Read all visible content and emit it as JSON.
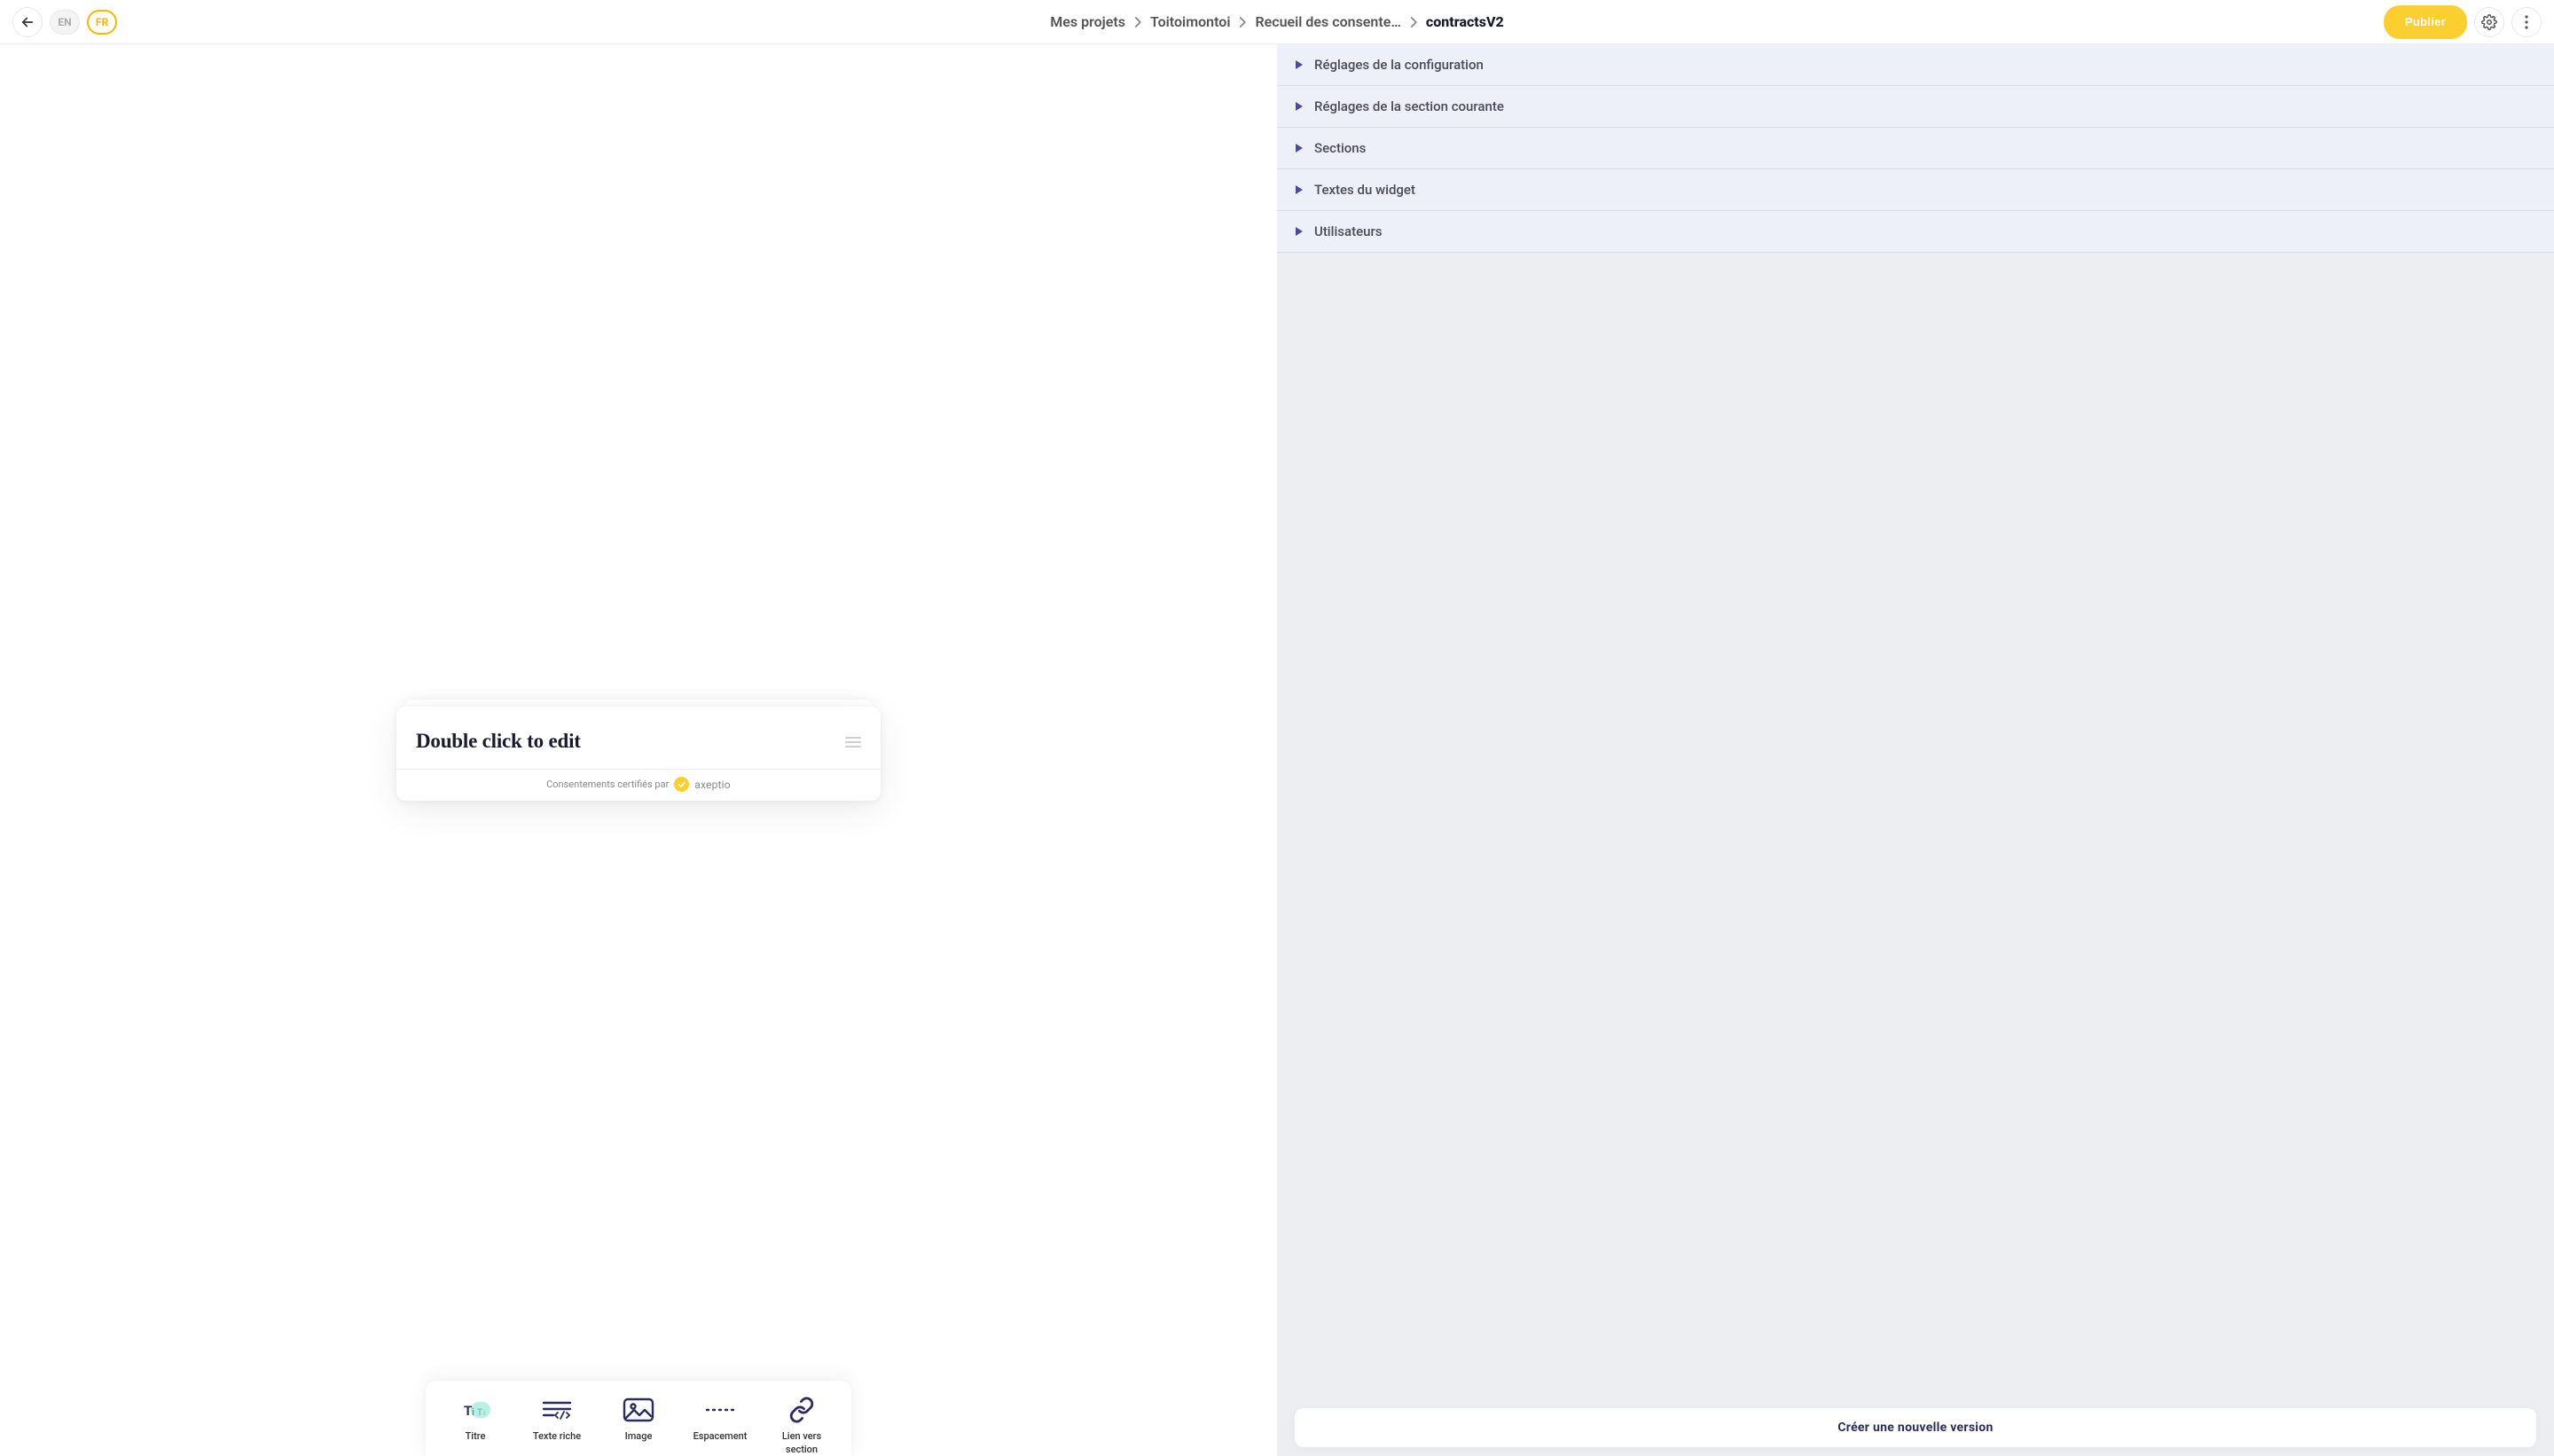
{
  "header": {
    "lang_inactive": "EN",
    "lang_active": "FR",
    "publish_label": "Publier"
  },
  "breadcrumb": {
    "items": [
      {
        "label": "Mes projets"
      },
      {
        "label": "Toitoimontoi"
      },
      {
        "label": "Recueil des consente…"
      },
      {
        "label": "contractsV2"
      }
    ]
  },
  "widget": {
    "title": "Double click to edit",
    "certified_text": "Consentements certifiés par",
    "brand_name": "axeptio"
  },
  "toolbox": {
    "items": [
      {
        "label": "Titre",
        "icon": "title"
      },
      {
        "label": "Texte riche",
        "icon": "rich-text"
      },
      {
        "label": "Image",
        "icon": "image"
      },
      {
        "label": "Espacement",
        "icon": "spacing"
      },
      {
        "label": "Lien vers section",
        "icon": "link"
      }
    ]
  },
  "accordion": {
    "items": [
      {
        "label": "Réglages de la configuration"
      },
      {
        "label": "Réglages de la section courante"
      },
      {
        "label": "Sections"
      },
      {
        "label": "Textes du widget"
      },
      {
        "label": "Utilisateurs"
      }
    ]
  },
  "right_footer": {
    "label": "Créer une nouvelle version"
  }
}
